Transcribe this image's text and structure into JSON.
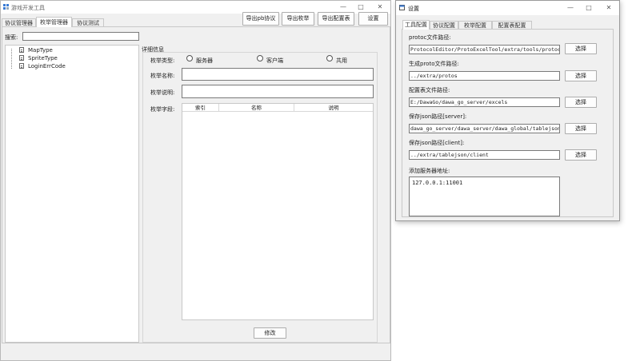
{
  "main_window": {
    "title": "游戏开发工具",
    "minimize": "—",
    "maximize": "□",
    "close": "✕",
    "tabs": [
      {
        "label": "协议管理器"
      },
      {
        "label": "枚举管理器"
      },
      {
        "label": "协议测试"
      }
    ],
    "toolbar": {
      "export_pb": "导出pb协议",
      "export_enum": "导出枚举",
      "export_config": "导出配置表",
      "settings": "设置"
    },
    "search": {
      "label": "搜索:",
      "value": ""
    },
    "tree": [
      {
        "label": "MapType"
      },
      {
        "label": "SpriteType"
      },
      {
        "label": "LoginErrCode"
      }
    ],
    "detail": {
      "title": "详细信息",
      "enum_type_label": "枚举类型:",
      "radios": [
        {
          "label": "服务器"
        },
        {
          "label": "客户端"
        },
        {
          "label": "共用"
        }
      ],
      "enum_name_label": "枚举名称:",
      "enum_name_value": "",
      "enum_desc_label": "枚举说明:",
      "enum_desc_value": "",
      "enum_fields_label": "枚举字段:",
      "table_headers": [
        "索引",
        "名称",
        "说明"
      ],
      "modify_button": "修改"
    }
  },
  "settings_window": {
    "title": "设置",
    "minimize": "—",
    "maximize": "□",
    "close": "✕",
    "tabs": [
      {
        "label": "工具配置"
      },
      {
        "label": "协议配置"
      },
      {
        "label": "枚举配置"
      },
      {
        "label": "配置表配置"
      }
    ],
    "fields": [
      {
        "label": "protoc文件路径:",
        "value": "ProtocolEditor/ProtoExcelTool/extra/tools/protoc",
        "button": "选择"
      },
      {
        "label": "生成proto文件路径:",
        "value": "../extra/protos",
        "button": "选择"
      },
      {
        "label": "配置表文件路径:",
        "value": "E:/DawaGo/dawa_go_server/excels",
        "button": "选择"
      },
      {
        "label": "保存json路径[server]:",
        "value": "dawa_go_server/dawa_server/dawa_global/tablejson",
        "button": "选择"
      },
      {
        "label": "保存json路径[client]:",
        "value": "../extra/tablejson/client",
        "button": "选择"
      }
    ],
    "server_address": {
      "label": "添加服务器地址:",
      "value": "127.0.0.1:11001"
    }
  },
  "colors": {
    "accent": "#0a64c8",
    "panel_border": "#c8c8c8",
    "window_bg": "#f0f0f0"
  }
}
